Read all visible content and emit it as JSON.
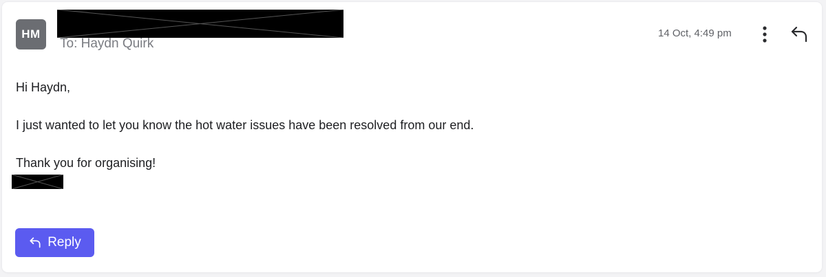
{
  "sender": {
    "avatar_initials": "HM",
    "name_redacted": true,
    "recipient_line": "To: Haydn Quirk"
  },
  "header": {
    "timestamp": "14 Oct, 4:49 pm",
    "more_icon": "more-vertical-icon",
    "reply_icon": "reply-arrow-icon"
  },
  "message": {
    "greeting": "Hi Haydn,",
    "body": "I just wanted to let you know the hot water issues have been resolved from our end.",
    "closing": "Thank you for organising!",
    "signature_redacted": true
  },
  "actions": {
    "reply_label": "Reply"
  },
  "colors": {
    "accent": "#5b5bf0",
    "avatar_bg": "#6b6d72",
    "muted_text": "#7a7c82"
  }
}
